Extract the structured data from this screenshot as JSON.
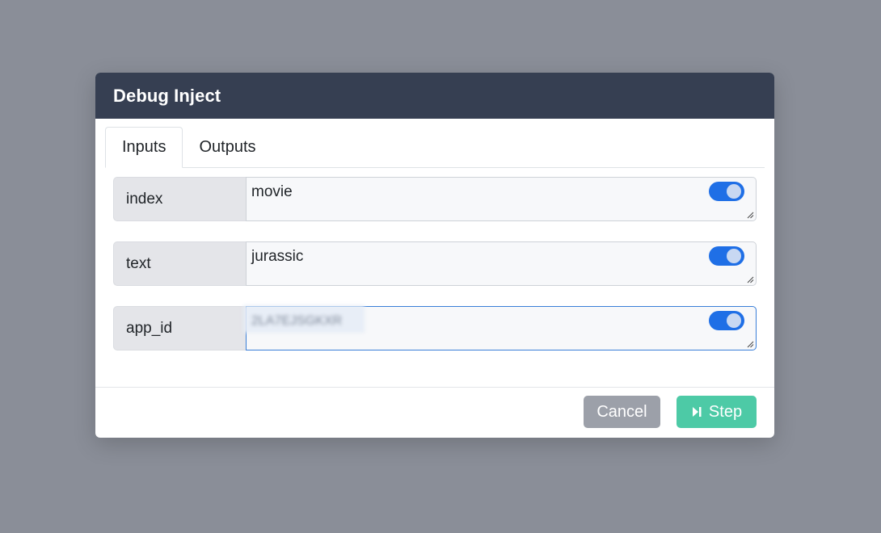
{
  "dialog": {
    "title": "Debug Inject",
    "tabs": [
      {
        "label": "Inputs",
        "active": true
      },
      {
        "label": "Outputs",
        "active": false
      }
    ],
    "fields": [
      {
        "label": "index",
        "value": "movie",
        "enabled": true
      },
      {
        "label": "text",
        "value": "jurassic",
        "enabled": true
      },
      {
        "label": "app_id",
        "value": "2LA7EJSGKXR",
        "enabled": true,
        "obscured": true,
        "focused": true
      }
    ],
    "buttons": {
      "cancel_label": "Cancel",
      "step_label": "Step",
      "step_icon": "step-forward-icon"
    }
  },
  "colors": {
    "header_bg": "#363f52",
    "toggle_on": "#1f6fe6",
    "step_button": "#4dcaa6",
    "cancel_button": "#9ca0a9",
    "backdrop": "#8a8e98"
  }
}
